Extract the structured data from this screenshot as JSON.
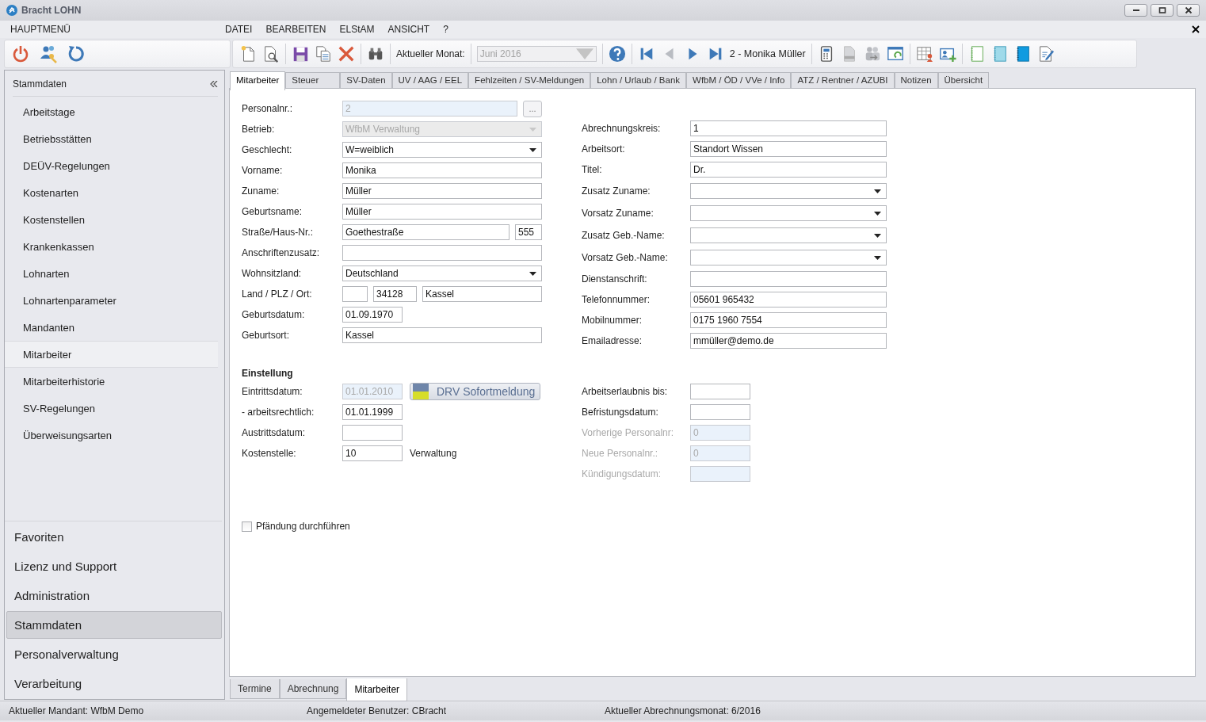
{
  "window": {
    "title": "Bracht LOHN"
  },
  "menu": {
    "main": "HAUPTMENÜ",
    "items": [
      "DATEI",
      "BEARBEITEN",
      "ELStAM",
      "ANSICHT",
      "?"
    ]
  },
  "toolbar": {
    "month_label": "Aktueller Monat:",
    "month": {
      "value": "Juni 2016",
      "disabled": true
    },
    "record": "2 - Monika Müller"
  },
  "sidebar": {
    "title": "Stammdaten",
    "items": [
      {
        "label": "Arbeitstage",
        "selected": false
      },
      {
        "label": "Betriebsstätten",
        "selected": false
      },
      {
        "label": "DEÜV-Regelungen",
        "selected": false
      },
      {
        "label": "Kostenarten",
        "selected": false
      },
      {
        "label": "Kostenstellen",
        "selected": false
      },
      {
        "label": "Krankenkassen",
        "selected": false
      },
      {
        "label": "Lohnarten",
        "selected": false
      },
      {
        "label": "Lohnartenparameter",
        "selected": false
      },
      {
        "label": "Mandanten",
        "selected": false
      },
      {
        "label": "Mitarbeiter",
        "selected": true
      },
      {
        "label": "Mitarbeiterhistorie",
        "selected": false
      },
      {
        "label": "SV-Regelungen",
        "selected": false
      },
      {
        "label": "Überweisungsarten",
        "selected": false
      }
    ],
    "groups": [
      {
        "label": "Favoriten",
        "selected": false
      },
      {
        "label": "Lizenz und Support",
        "selected": false
      },
      {
        "label": "Administration",
        "selected": false
      },
      {
        "label": "Stammdaten",
        "selected": true
      },
      {
        "label": "Personalverwaltung",
        "selected": false
      },
      {
        "label": "Verarbeitung",
        "selected": false
      }
    ]
  },
  "tabs": [
    {
      "label": "Mitarbeiter",
      "selected": true
    },
    {
      "label": "Steuer",
      "selected": false
    },
    {
      "label": "SV-Daten",
      "selected": false
    },
    {
      "label": "UV / AAG / EEL",
      "selected": false
    },
    {
      "label": "Fehlzeiten / SV-Meldungen",
      "selected": false
    },
    {
      "label": "Lohn / Urlaub / Bank",
      "selected": false
    },
    {
      "label": "WfbM / ÖD / VVe / Info",
      "selected": false
    },
    {
      "label": "ATZ / Rentner / AZUBI",
      "selected": false
    },
    {
      "label": "Notizen",
      "selected": false
    },
    {
      "label": "Übersicht",
      "selected": false
    }
  ],
  "form": {
    "left": [
      {
        "label": "Personalnr.:",
        "disabled": false,
        "fields": [
          {
            "kind": "text",
            "value": "2",
            "disabled": true
          },
          {
            "kind": "browse",
            "value": "...",
            "disabled": false
          }
        ]
      },
      {
        "label": "Betrieb:",
        "disabled": false,
        "fields": [
          {
            "kind": "combo",
            "value": "WfbM Verwaltung",
            "disabled": true
          }
        ]
      },
      {
        "label": "Geschlecht:",
        "disabled": false,
        "fields": [
          {
            "kind": "combo",
            "value": "W=weiblich",
            "disabled": false
          }
        ]
      },
      {
        "label": "Vorname:",
        "disabled": false,
        "fields": [
          {
            "kind": "text",
            "value": "Monika",
            "disabled": false
          }
        ]
      },
      {
        "label": "Zuname:",
        "disabled": false,
        "fields": [
          {
            "kind": "text",
            "value": "Müller",
            "disabled": false
          }
        ]
      },
      {
        "label": "Geburtsname:",
        "disabled": false,
        "fields": [
          {
            "kind": "text",
            "value": "Müller",
            "disabled": false
          }
        ]
      },
      {
        "label": "Straße/Haus-Nr.:",
        "disabled": false,
        "fields": [
          {
            "kind": "text",
            "value": "Goethestraße",
            "disabled": false
          },
          {
            "kind": "number",
            "value": "555",
            "disabled": false
          }
        ]
      },
      {
        "label": "Anschriftenzusatz:",
        "disabled": false,
        "fields": [
          {
            "kind": "text",
            "disabled": false
          }
        ]
      },
      {
        "label": "Wohnsitzland:",
        "disabled": false,
        "fields": [
          {
            "kind": "combo",
            "value": "Deutschland",
            "disabled": false
          }
        ]
      },
      {
        "label": "Land / PLZ / Ort:",
        "disabled": false,
        "fields": [
          {
            "kind": "code",
            "disabled": false
          },
          {
            "kind": "zip",
            "value": "34128",
            "disabled": false
          },
          {
            "kind": "text",
            "value": "Kassel",
            "disabled": false
          }
        ]
      },
      {
        "label": "Geburtsdatum:",
        "disabled": false,
        "fields": [
          {
            "kind": "date",
            "value": "01.09.1970",
            "disabled": false
          }
        ]
      },
      {
        "label": "Geburtsort:",
        "disabled": false,
        "fields": [
          {
            "kind": "text",
            "value": "Kassel",
            "disabled": false
          }
        ]
      }
    ],
    "right": [
      {
        "label": "Abrechnungskreis:",
        "disabled": false,
        "fields": [
          {
            "kind": "text",
            "value": "1",
            "disabled": false
          }
        ]
      },
      {
        "label": "Arbeitsort:",
        "disabled": false,
        "fields": [
          {
            "kind": "text",
            "value": "Standort Wissen",
            "disabled": false
          }
        ]
      },
      {
        "label": "Titel:",
        "disabled": false,
        "fields": [
          {
            "kind": "text",
            "value": "Dr.",
            "disabled": false
          }
        ]
      },
      {
        "label": "Zusatz Zuname:",
        "disabled": false,
        "fields": [
          {
            "kind": "combo",
            "disabled": false
          }
        ]
      },
      {
        "label": "Vorsatz Zuname:",
        "disabled": false,
        "fields": [
          {
            "kind": "combo",
            "disabled": false
          }
        ]
      },
      {
        "label": "Zusatz Geb.-Name:",
        "disabled": false,
        "fields": [
          {
            "kind": "combo",
            "disabled": false
          }
        ]
      },
      {
        "label": "Vorsatz Geb.-Name:",
        "disabled": false,
        "fields": [
          {
            "kind": "combo",
            "disabled": false
          }
        ]
      },
      {
        "label": "Dienstanschrift:",
        "disabled": false,
        "fields": [
          {
            "kind": "text",
            "disabled": false
          }
        ]
      },
      {
        "label": "Telefonnummer:",
        "disabled": false,
        "fields": [
          {
            "kind": "text",
            "value": "05601 965432",
            "disabled": false
          }
        ]
      },
      {
        "label": "Mobilnummer:",
        "disabled": false,
        "fields": [
          {
            "kind": "text",
            "value": "0175 1960 7554",
            "disabled": false
          }
        ]
      },
      {
        "label": "Emailadresse:",
        "disabled": false,
        "fields": [
          {
            "kind": "text",
            "value": "mmüller@demo.de",
            "disabled": false
          }
        ]
      }
    ],
    "section": {
      "title": "Einstellung",
      "left": [
        {
          "label": "Eintrittsdatum:",
          "disabled": false,
          "fields": [
            {
              "kind": "date",
              "value": "01.01.2010",
              "disabled": true
            },
            {
              "kind": "drv",
              "value": "DRV Sofortmeldung",
              "disabled": false
            }
          ]
        },
        {
          "label": "- arbeitsrechtlich:",
          "disabled": false,
          "fields": [
            {
              "kind": "date",
              "value": "01.01.1999",
              "disabled": false
            }
          ]
        },
        {
          "label": "Austrittsdatum:",
          "disabled": false,
          "fields": [
            {
              "kind": "date",
              "disabled": false
            }
          ]
        },
        {
          "label": "Kostenstelle:",
          "disabled": false,
          "fields": [
            {
              "kind": "date",
              "value": "10",
              "disabled": false
            },
            {
              "kind": "note",
              "value": "Verwaltung",
              "disabled": false
            }
          ]
        }
      ],
      "right": [
        {
          "label": "Arbeitserlaubnis bis:",
          "disabled": false,
          "fields": [
            {
              "kind": "date",
              "disabled": false
            }
          ]
        },
        {
          "label": "Befristungsdatum:",
          "disabled": false,
          "fields": [
            {
              "kind": "date",
              "disabled": false
            }
          ]
        },
        {
          "label": "Vorherige Personalnr:",
          "disabled": true,
          "fields": [
            {
              "kind": "date",
              "value": "0",
              "disabled": true
            }
          ]
        },
        {
          "label": "Neue Personalnr.:",
          "disabled": true,
          "fields": [
            {
              "kind": "date",
              "value": "0",
              "disabled": true
            }
          ]
        },
        {
          "label": "Kündigungsdatum:",
          "disabled": true,
          "fields": [
            {
              "kind": "date",
              "disabled": true
            }
          ]
        }
      ]
    },
    "checkbox": {
      "label": "Pfändung durchführen",
      "checked": false
    }
  },
  "bottom_tabs": [
    {
      "label": "Termine",
      "selected": false
    },
    {
      "label": "Abrechnung",
      "selected": false
    },
    {
      "label": "Mitarbeiter",
      "selected": true
    }
  ],
  "status_bar": [
    "Aktueller Mandant: WfbM Demo",
    "Angemeldeter Benutzer: CBracht",
    "Aktueller Abrechnungsmonat: 6/2016"
  ]
}
